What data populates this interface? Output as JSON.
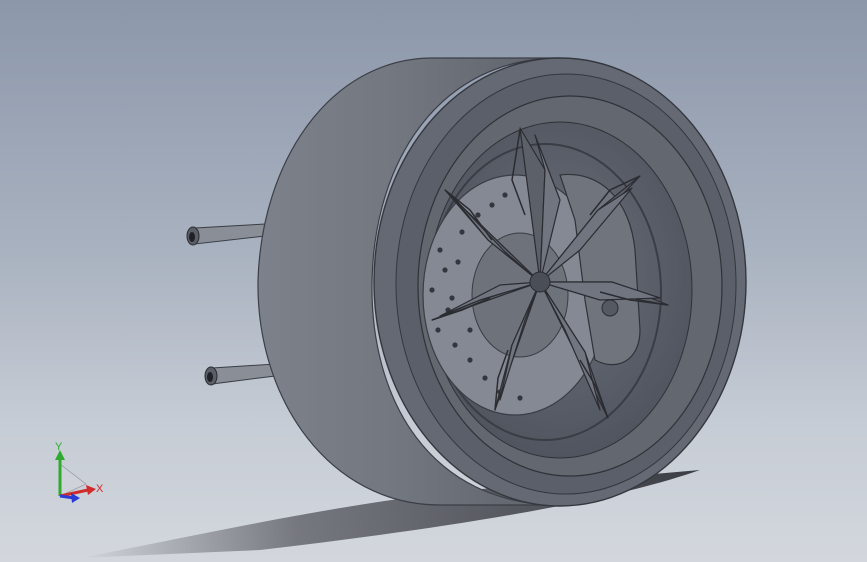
{
  "viewport": {
    "model": "wheel-assembly",
    "background_top": "#8c97aa",
    "background_bottom": "#d3d7dd"
  },
  "colors": {
    "tire": "#6c707b",
    "rim": "#585c67",
    "spoke": "#4b4f5a",
    "disc": "#7f838d",
    "shadow": "#2b2d33"
  },
  "triad": {
    "y_label": "Y",
    "x_label": "X",
    "y_color": "#2faa2f",
    "x_color": "#d22b2b",
    "z_color": "#2a3bd6"
  }
}
